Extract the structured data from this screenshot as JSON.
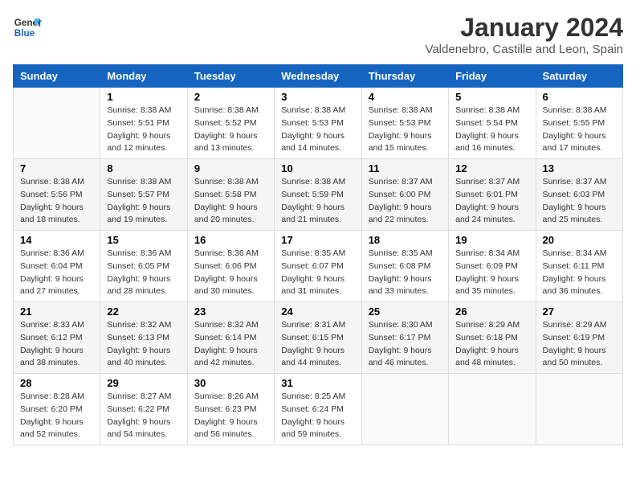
{
  "header": {
    "logo_line1": "General",
    "logo_line2": "Blue",
    "main_title": "January 2024",
    "subtitle": "Valdenebro, Castille and Leon, Spain"
  },
  "days_of_week": [
    "Sunday",
    "Monday",
    "Tuesday",
    "Wednesday",
    "Thursday",
    "Friday",
    "Saturday"
  ],
  "weeks": [
    [
      {
        "day": "",
        "info": ""
      },
      {
        "day": "1",
        "info": "Sunrise: 8:38 AM\nSunset: 5:51 PM\nDaylight: 9 hours\nand 12 minutes."
      },
      {
        "day": "2",
        "info": "Sunrise: 8:38 AM\nSunset: 5:52 PM\nDaylight: 9 hours\nand 13 minutes."
      },
      {
        "day": "3",
        "info": "Sunrise: 8:38 AM\nSunset: 5:53 PM\nDaylight: 9 hours\nand 14 minutes."
      },
      {
        "day": "4",
        "info": "Sunrise: 8:38 AM\nSunset: 5:53 PM\nDaylight: 9 hours\nand 15 minutes."
      },
      {
        "day": "5",
        "info": "Sunrise: 8:38 AM\nSunset: 5:54 PM\nDaylight: 9 hours\nand 16 minutes."
      },
      {
        "day": "6",
        "info": "Sunrise: 8:38 AM\nSunset: 5:55 PM\nDaylight: 9 hours\nand 17 minutes."
      }
    ],
    [
      {
        "day": "7",
        "info": "Sunrise: 8:38 AM\nSunset: 5:56 PM\nDaylight: 9 hours\nand 18 minutes."
      },
      {
        "day": "8",
        "info": "Sunrise: 8:38 AM\nSunset: 5:57 PM\nDaylight: 9 hours\nand 19 minutes."
      },
      {
        "day": "9",
        "info": "Sunrise: 8:38 AM\nSunset: 5:58 PM\nDaylight: 9 hours\nand 20 minutes."
      },
      {
        "day": "10",
        "info": "Sunrise: 8:38 AM\nSunset: 5:59 PM\nDaylight: 9 hours\nand 21 minutes."
      },
      {
        "day": "11",
        "info": "Sunrise: 8:37 AM\nSunset: 6:00 PM\nDaylight: 9 hours\nand 22 minutes."
      },
      {
        "day": "12",
        "info": "Sunrise: 8:37 AM\nSunset: 6:01 PM\nDaylight: 9 hours\nand 24 minutes."
      },
      {
        "day": "13",
        "info": "Sunrise: 8:37 AM\nSunset: 6:03 PM\nDaylight: 9 hours\nand 25 minutes."
      }
    ],
    [
      {
        "day": "14",
        "info": "Sunrise: 8:36 AM\nSunset: 6:04 PM\nDaylight: 9 hours\nand 27 minutes."
      },
      {
        "day": "15",
        "info": "Sunrise: 8:36 AM\nSunset: 6:05 PM\nDaylight: 9 hours\nand 28 minutes."
      },
      {
        "day": "16",
        "info": "Sunrise: 8:36 AM\nSunset: 6:06 PM\nDaylight: 9 hours\nand 30 minutes."
      },
      {
        "day": "17",
        "info": "Sunrise: 8:35 AM\nSunset: 6:07 PM\nDaylight: 9 hours\nand 31 minutes."
      },
      {
        "day": "18",
        "info": "Sunrise: 8:35 AM\nSunset: 6:08 PM\nDaylight: 9 hours\nand 33 minutes."
      },
      {
        "day": "19",
        "info": "Sunrise: 8:34 AM\nSunset: 6:09 PM\nDaylight: 9 hours\nand 35 minutes."
      },
      {
        "day": "20",
        "info": "Sunrise: 8:34 AM\nSunset: 6:11 PM\nDaylight: 9 hours\nand 36 minutes."
      }
    ],
    [
      {
        "day": "21",
        "info": "Sunrise: 8:33 AM\nSunset: 6:12 PM\nDaylight: 9 hours\nand 38 minutes."
      },
      {
        "day": "22",
        "info": "Sunrise: 8:32 AM\nSunset: 6:13 PM\nDaylight: 9 hours\nand 40 minutes."
      },
      {
        "day": "23",
        "info": "Sunrise: 8:32 AM\nSunset: 6:14 PM\nDaylight: 9 hours\nand 42 minutes."
      },
      {
        "day": "24",
        "info": "Sunrise: 8:31 AM\nSunset: 6:15 PM\nDaylight: 9 hours\nand 44 minutes."
      },
      {
        "day": "25",
        "info": "Sunrise: 8:30 AM\nSunset: 6:17 PM\nDaylight: 9 hours\nand 46 minutes."
      },
      {
        "day": "26",
        "info": "Sunrise: 8:29 AM\nSunset: 6:18 PM\nDaylight: 9 hours\nand 48 minutes."
      },
      {
        "day": "27",
        "info": "Sunrise: 8:29 AM\nSunset: 6:19 PM\nDaylight: 9 hours\nand 50 minutes."
      }
    ],
    [
      {
        "day": "28",
        "info": "Sunrise: 8:28 AM\nSunset: 6:20 PM\nDaylight: 9 hours\nand 52 minutes."
      },
      {
        "day": "29",
        "info": "Sunrise: 8:27 AM\nSunset: 6:22 PM\nDaylight: 9 hours\nand 54 minutes."
      },
      {
        "day": "30",
        "info": "Sunrise: 8:26 AM\nSunset: 6:23 PM\nDaylight: 9 hours\nand 56 minutes."
      },
      {
        "day": "31",
        "info": "Sunrise: 8:25 AM\nSunset: 6:24 PM\nDaylight: 9 hours\nand 59 minutes."
      },
      {
        "day": "",
        "info": ""
      },
      {
        "day": "",
        "info": ""
      },
      {
        "day": "",
        "info": ""
      }
    ]
  ]
}
